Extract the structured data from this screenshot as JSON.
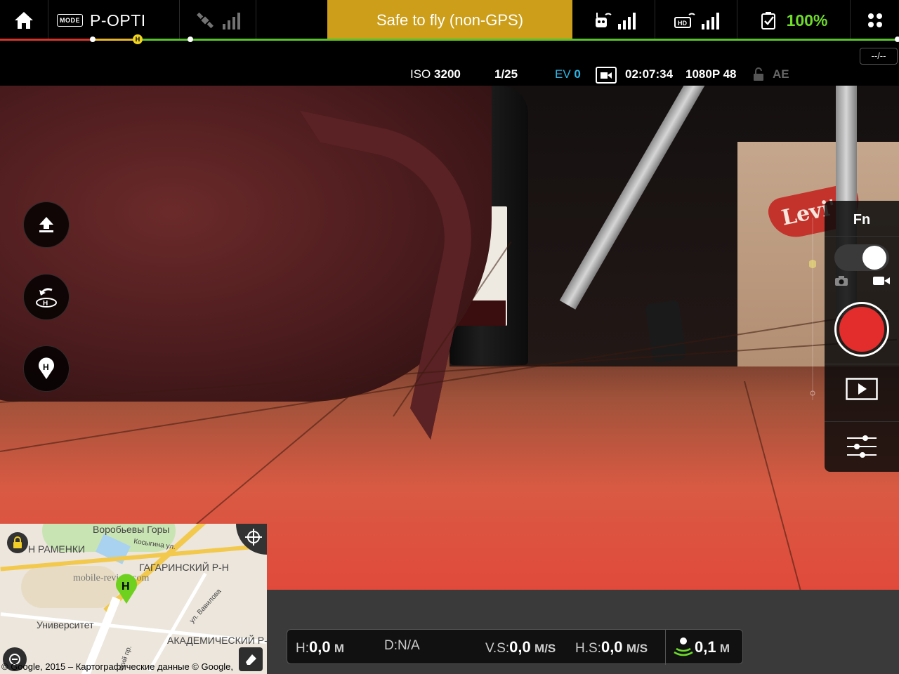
{
  "topbar": {
    "mode_box": "MODE",
    "mode_label": "P-OPTI",
    "status": "Safe to fly (non-GPS)",
    "battery_percent": "100%",
    "distance_pill": "--/--",
    "home_marker": "H"
  },
  "camera_info": {
    "iso_label": "ISO",
    "iso_value": "3200",
    "shutter": "1/25",
    "ev_label": "EV",
    "ev_value": "0",
    "record_time": "02:07:34",
    "resolution": "1080P 48",
    "ae": "AE"
  },
  "camera_panel": {
    "fn": "Fn"
  },
  "scene": {
    "logo_text": "Levi's"
  },
  "map": {
    "labels": {
      "vorobyovy": "Воробьевы Горы",
      "ramenki": "Н РАМЕНКИ",
      "kosygina": "Косыгина ул.",
      "gagarinsky": "ГАГАРИНСКИЙ Р-Н",
      "watermark": "mobile-review.com",
      "universitet": "Университет",
      "vavilova": "ул. Вавилова",
      "akademichesky": "АКАДЕМИЧЕСКИЙ Р-Н",
      "prospekt": "ский пр."
    },
    "home_pin": "H",
    "copyright": "© Google, 2015 – Картографические данные © Google,"
  },
  "telemetry": {
    "h_key": "H:",
    "h_val": "0,0",
    "h_unit": "M",
    "d_key": "D:",
    "d_val": "N/A",
    "vs_key": "V.S:",
    "vs_val": "0,0",
    "vs_unit": "M/S",
    "hs_key": "H.S:",
    "hs_val": "0,0",
    "hs_unit": "M/S",
    "vps_val": "0,1",
    "vps_unit": "M"
  },
  "colors": {
    "status_bg": "#cc9e1a",
    "battery": "#6edb2b",
    "ev": "#2fb6e6",
    "record": "#e32c2c",
    "home_pin": "#6fd11f"
  },
  "icons": [
    "home-icon",
    "mode-icon",
    "satellite-icon",
    "signal-bars-icon",
    "remote-controller-icon",
    "hd-link-icon",
    "battery-icon",
    "menu-grid-icon",
    "lock-icon",
    "video-camera-icon",
    "takeoff-icon",
    "return-home-icon",
    "home-point-icon",
    "photo-camera-icon",
    "playback-icon",
    "settings-sliders-icon",
    "map-lock-icon",
    "locate-icon",
    "zoom-out-icon",
    "eraser-icon",
    "vision-sensor-icon"
  ]
}
